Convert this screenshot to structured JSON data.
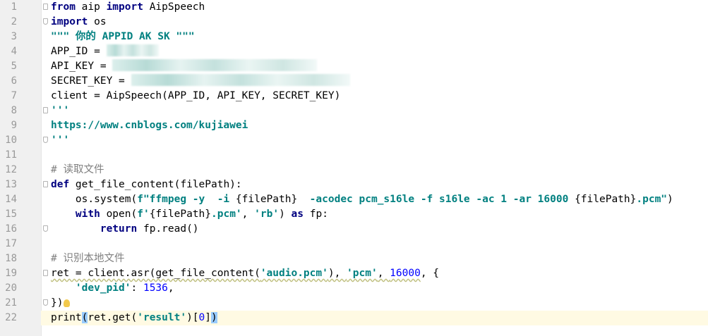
{
  "editor": {
    "language": "python",
    "current_line": 22,
    "lines": [
      {
        "n": "1",
        "parts": [
          {
            "t": "from",
            "c": "kw"
          },
          {
            "t": " aip ",
            "c": ""
          },
          {
            "t": "import",
            "c": "kw"
          },
          {
            "t": " AipSpeech",
            "c": ""
          }
        ],
        "fold": "start"
      },
      {
        "n": "2",
        "parts": [
          {
            "t": "import",
            "c": "kw"
          },
          {
            "t": " os",
            "c": ""
          }
        ],
        "fold": "end"
      },
      {
        "n": "3",
        "parts": [
          {
            "t": "\"\"\" 你的 APPID AK SK \"\"\"",
            "c": "str"
          }
        ]
      },
      {
        "n": "4",
        "parts": [
          {
            "t": "APP_ID = ",
            "c": ""
          }
        ],
        "blur": "b1"
      },
      {
        "n": "5",
        "parts": [
          {
            "t": "API_KEY = ",
            "c": ""
          }
        ],
        "blur": "b2"
      },
      {
        "n": "6",
        "parts": [
          {
            "t": "SECRET_KEY = ",
            "c": ""
          }
        ],
        "blur": "b3"
      },
      {
        "n": "7",
        "parts": [
          {
            "t": "client = AipSpeech(APP_ID, API_KEY, SECRET_KEY)",
            "c": ""
          }
        ]
      },
      {
        "n": "8",
        "parts": [
          {
            "t": "'''",
            "c": "str"
          }
        ],
        "fold": "start"
      },
      {
        "n": "9",
        "parts": [
          {
            "t": "https://www.cnblogs.com/kujiawei",
            "c": "str"
          }
        ]
      },
      {
        "n": "10",
        "parts": [
          {
            "t": "'''",
            "c": "str"
          }
        ],
        "fold": "end"
      },
      {
        "n": "11",
        "parts": []
      },
      {
        "n": "12",
        "parts": [
          {
            "t": "# 读取文件",
            "c": "cmt"
          }
        ]
      },
      {
        "n": "13",
        "parts": [
          {
            "t": "def",
            "c": "kw"
          },
          {
            "t": " get_file_content(filePath):",
            "c": ""
          }
        ],
        "fold": "start"
      },
      {
        "n": "14",
        "parts": [
          {
            "t": "    os.system(",
            "c": ""
          },
          {
            "t": "f\"ffmpeg -y  -i ",
            "c": "str"
          },
          {
            "t": "{filePath}",
            "c": ""
          },
          {
            "t": "  -acodec pcm_s16le -f s16le -ac 1 -ar 16000 ",
            "c": "str"
          },
          {
            "t": "{filePath}",
            "c": ""
          },
          {
            "t": ".pcm\"",
            "c": "str"
          },
          {
            "t": ")",
            "c": ""
          }
        ]
      },
      {
        "n": "15",
        "parts": [
          {
            "t": "    ",
            "c": ""
          },
          {
            "t": "with",
            "c": "kw"
          },
          {
            "t": " open(",
            "c": ""
          },
          {
            "t": "f'",
            "c": "str"
          },
          {
            "t": "{filePath}",
            "c": ""
          },
          {
            "t": ".pcm'",
            "c": "str"
          },
          {
            "t": ", ",
            "c": ""
          },
          {
            "t": "'rb'",
            "c": "str"
          },
          {
            "t": ") ",
            "c": ""
          },
          {
            "t": "as",
            "c": "kw"
          },
          {
            "t": " fp:",
            "c": ""
          }
        ]
      },
      {
        "n": "16",
        "parts": [
          {
            "t": "        ",
            "c": ""
          },
          {
            "t": "return",
            "c": "kw"
          },
          {
            "t": " fp.read()",
            "c": ""
          }
        ],
        "fold": "end"
      },
      {
        "n": "17",
        "parts": []
      },
      {
        "n": "18",
        "parts": [
          {
            "t": "# 识别本地文件",
            "c": "cmt"
          }
        ]
      },
      {
        "n": "19",
        "parts": [
          {
            "t": "ret = client.asr(get_file_content(",
            "c": "wavy"
          },
          {
            "t": "'audio.pcm'",
            "c": "str wavy"
          },
          {
            "t": "), ",
            "c": "wavy"
          },
          {
            "t": "'pcm'",
            "c": "str wavy"
          },
          {
            "t": ", ",
            "c": "wavy"
          },
          {
            "t": "16000",
            "c": "num wavy"
          },
          {
            "t": ", {",
            "c": ""
          }
        ],
        "fold": "start"
      },
      {
        "n": "20",
        "parts": [
          {
            "t": "    ",
            "c": ""
          },
          {
            "t": "'dev_pid'",
            "c": "str"
          },
          {
            "t": ": ",
            "c": ""
          },
          {
            "t": "1536",
            "c": "num"
          },
          {
            "t": ",",
            "c": ""
          }
        ]
      },
      {
        "n": "21",
        "parts": [
          {
            "t": "})",
            "c": ""
          }
        ],
        "fold": "end",
        "bulb": true
      },
      {
        "n": "22",
        "parts": [
          {
            "t": "print",
            "c": ""
          },
          {
            "t": "(",
            "c": "brace-hl"
          },
          {
            "t": "ret.get(",
            "c": ""
          },
          {
            "t": "'result'",
            "c": "str"
          },
          {
            "t": ")[",
            "c": ""
          },
          {
            "t": "0",
            "c": "num"
          },
          {
            "t": "]",
            "c": ""
          },
          {
            "t": ")",
            "c": "brace-hl"
          }
        ]
      }
    ]
  }
}
